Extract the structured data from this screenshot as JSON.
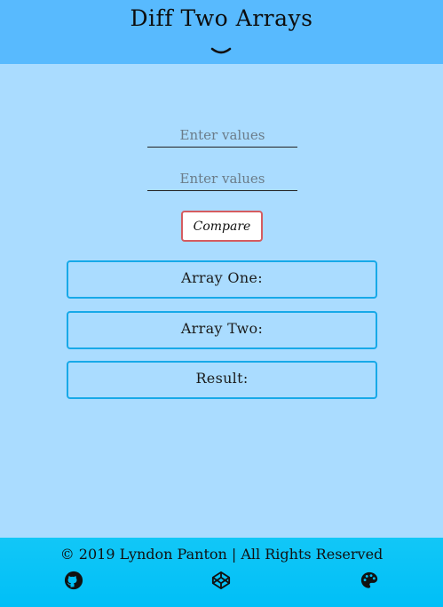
{
  "header": {
    "title": "Diff Two Arrays",
    "toggle_icon": "chevron-down-icon"
  },
  "form": {
    "input_one_placeholder": "Enter values",
    "input_two_placeholder": "Enter values",
    "compare_label": "Compare"
  },
  "results": {
    "array_one_label": "Array One:",
    "array_two_label": "Array Two:",
    "result_label": "Result:"
  },
  "footer": {
    "copyright": "© 2019 Lyndon Panton | All Rights Reserved",
    "icons": [
      "github-icon",
      "codepen-icon",
      "palette-icon"
    ]
  },
  "colors": {
    "header_bg": "#58bafe",
    "body_bg": "#aadcff",
    "footer_bg": "#00bff7",
    "button_border": "#d55c60",
    "box_border": "#17a9e8"
  }
}
